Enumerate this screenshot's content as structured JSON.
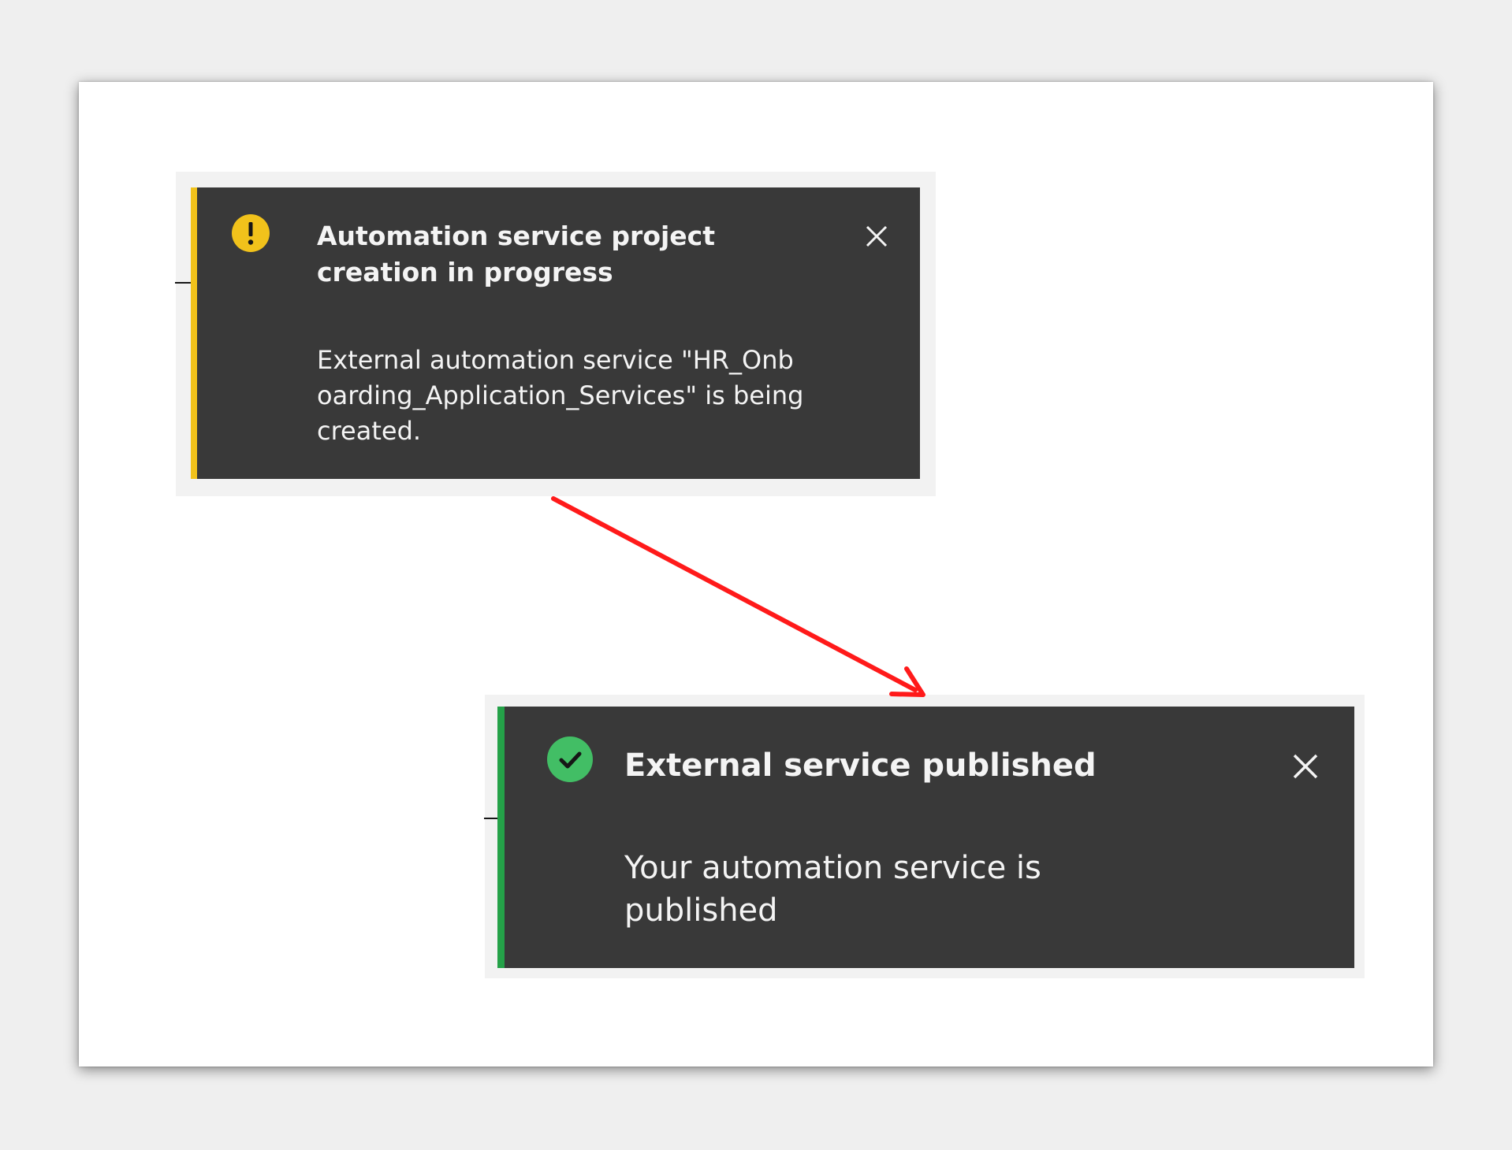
{
  "colors": {
    "page_background": "#efefef",
    "sheet_background": "#ffffff",
    "toast_background": "#393939",
    "toast_text": "#f4f4f4",
    "warning_accent": "#f1c21b",
    "success_accent": "#24a148",
    "success_icon": "#42be65",
    "arrow": "#ff1a1a"
  },
  "notifications": [
    {
      "kind": "warning",
      "icon": "warning-filled-icon",
      "title": "Automation service project creation in progress",
      "message": "External automation service \"HR_Onboarding_Application_Services\" is being created.",
      "close_icon": "close-icon"
    },
    {
      "kind": "success",
      "icon": "checkmark-filled-icon",
      "title": "External service published",
      "message": "Your automation service is published",
      "close_icon": "close-icon"
    }
  ],
  "annotation": {
    "icon": "transition-arrow-icon"
  }
}
